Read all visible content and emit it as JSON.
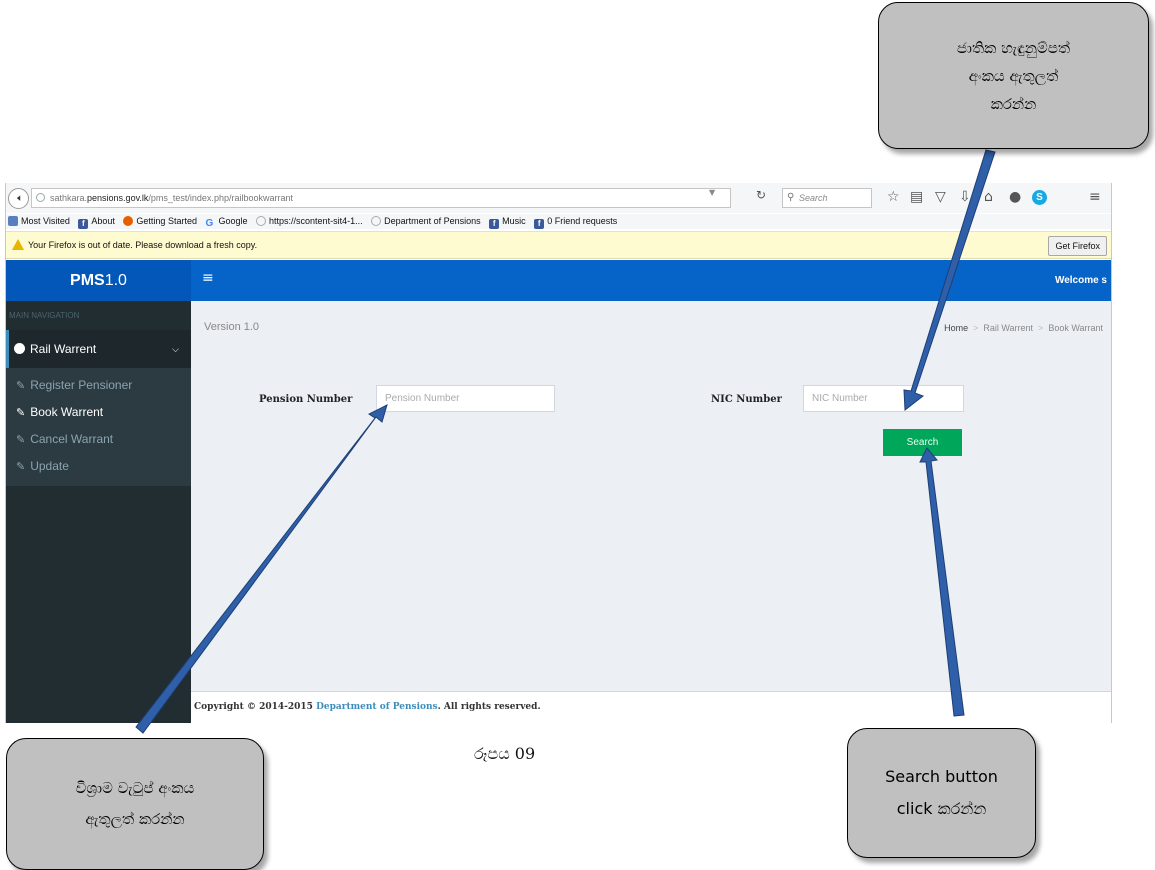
{
  "browser": {
    "url_host": "sathkara.pensions.gov.lk",
    "url_path": "/pms_test/index.php/railbookwarrant",
    "url_prefix": "sathkara.",
    "url_domain": "pensions.gov.lk",
    "search_placeholder": "Search",
    "bookmarks": [
      "Most Visited",
      "About",
      "Getting Started",
      "Google",
      "https://scontent-sit4-1...",
      "Department of Pensions",
      "Music",
      "0 Friend requests"
    ],
    "notification": "Your Firefox is out of date. Please download a fresh copy.",
    "get_firefox": "Get Firefox"
  },
  "app": {
    "brand_bold": "PMS",
    "brand_version": "1.0",
    "welcome": "Welcome s",
    "nav_header": "MAIN NAVIGATION",
    "menu_parent": "Rail Warrent",
    "menu_items": [
      "Register Pensioner",
      "Book Warrent",
      "Cancel Warrant",
      "Update"
    ],
    "version": "Version 1.0",
    "breadcrumb": [
      "Home",
      "Rail Warrent",
      "Book Warrant"
    ],
    "form": {
      "pension_label": "Pension Number",
      "pension_placeholder": "Pension Number",
      "nic_label": "NIC Number",
      "nic_placeholder": "NIC Number",
      "search_button": "Search"
    },
    "footer": {
      "prefix": "Copyright © 2014-2015 ",
      "link": "Department of Pensions",
      "suffix": ". All rights reserved."
    }
  },
  "annotations": {
    "top_right": [
      "ජාතික හැඳුනුම්පත්",
      "අංකය ඇතුලත්",
      "කරන්න"
    ],
    "bottom_left": [
      "විශ්‍රාම වැටුප් අංකය",
      "ඇතුලත් කරන්න"
    ],
    "bottom_right": [
      "Search button",
      "click කරන්න"
    ],
    "figure_caption": "රූපය 09"
  },
  "colors": {
    "header_blue": "#0664c8",
    "sidebar_dark": "#222d32",
    "search_green": "#00a65a",
    "callout_gray": "#c0c0c0",
    "arrow_blue": "#2e5fa8"
  }
}
